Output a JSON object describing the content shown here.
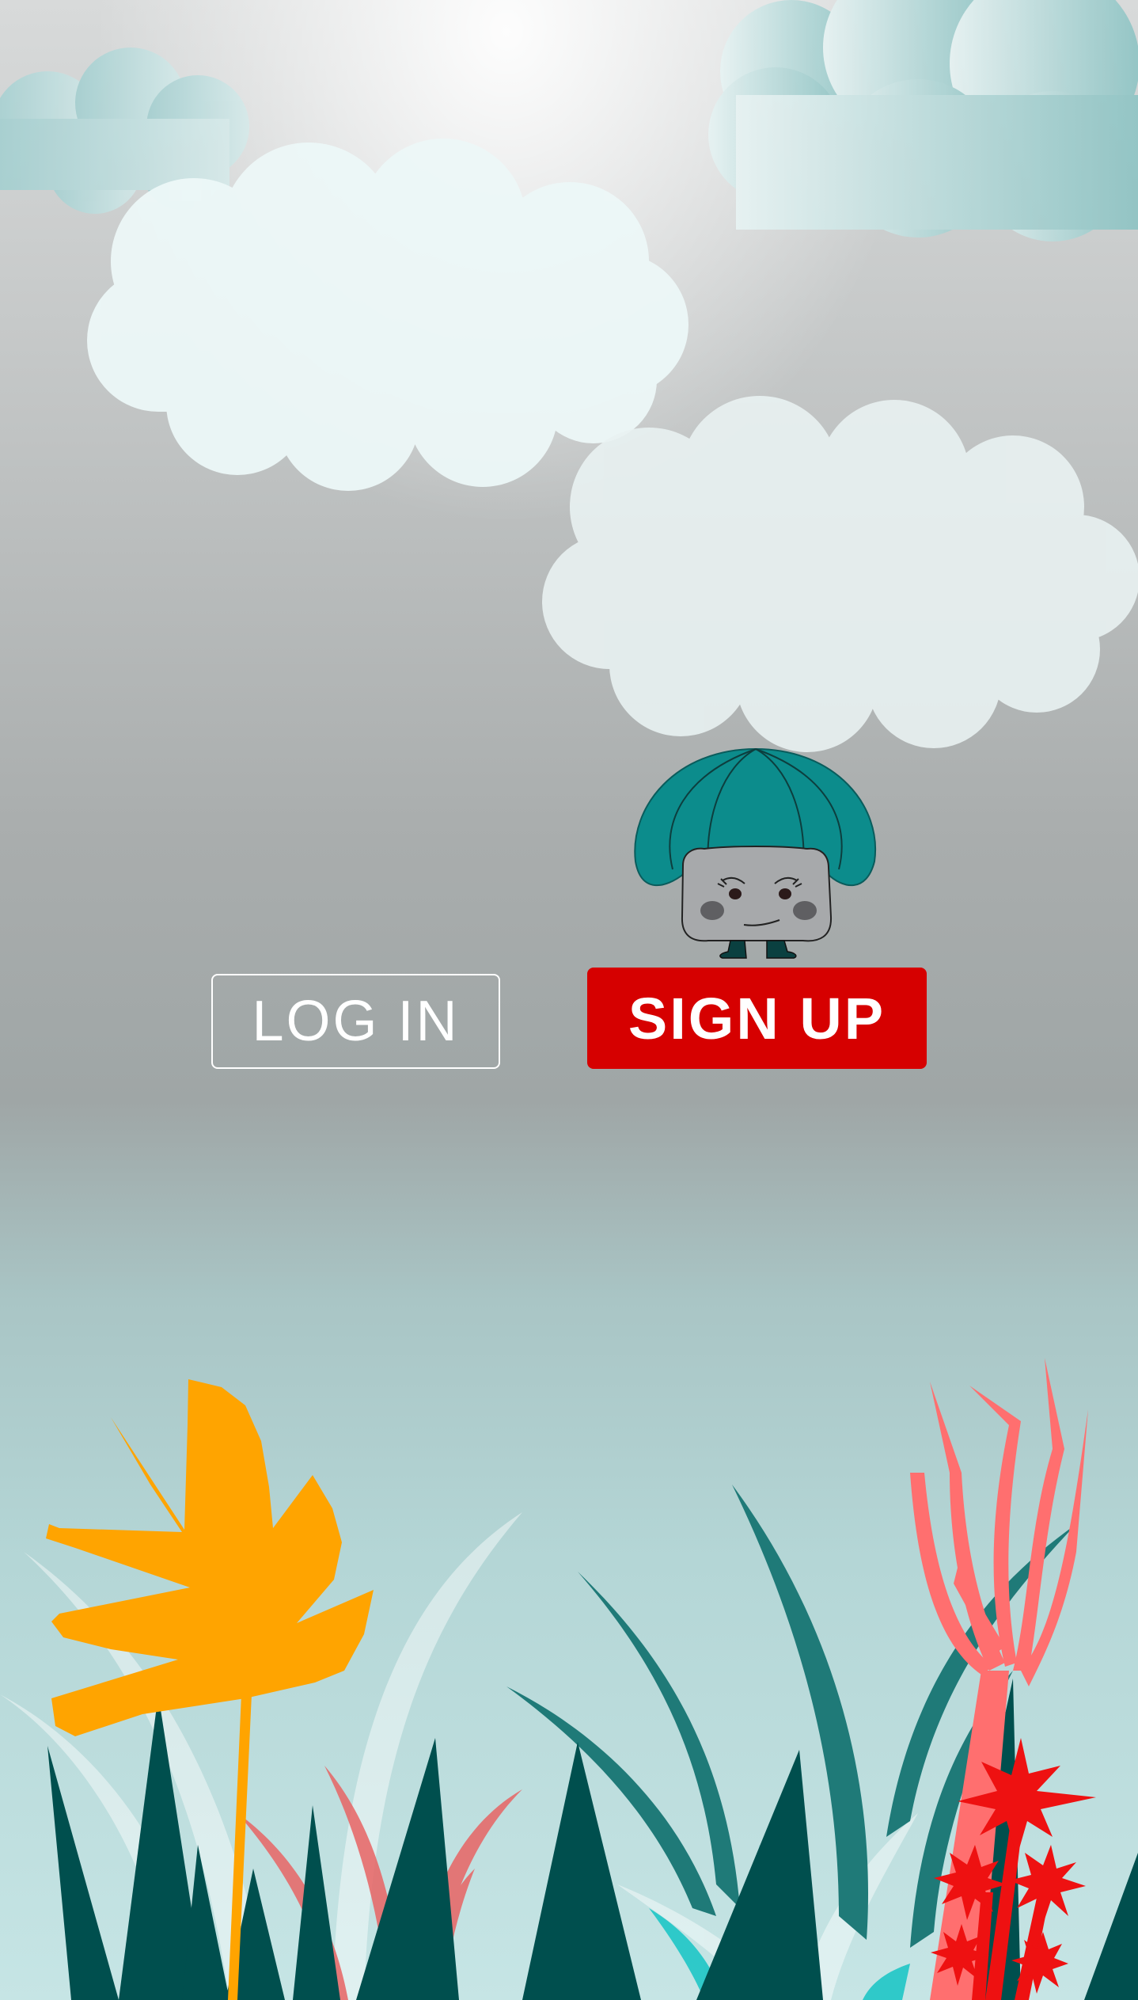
{
  "screen": {
    "login_label": "LOG IN",
    "signup_label": "SIGN UP"
  },
  "colors": {
    "signup_button": "#d60000",
    "mascot_cap": "#0c8c8c",
    "plant_orange": "#ffa400",
    "plant_coral": "#ff6f6f",
    "plant_red": "#ee1111",
    "grass_dark": "#00504f",
    "grass_teal": "#1a7a78",
    "grass_cyan": "#12c0c0"
  },
  "icons": {
    "mascot": "mushroom-mascot-icon"
  }
}
